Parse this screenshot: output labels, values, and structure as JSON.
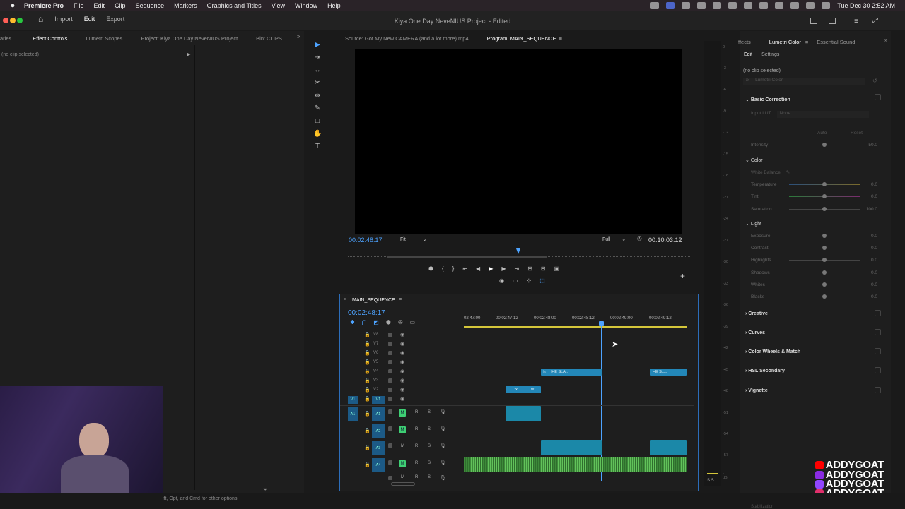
{
  "menubar": {
    "app_name": "Premiere Pro",
    "items": [
      "File",
      "Edit",
      "Clip",
      "Sequence",
      "Markers",
      "Graphics and Titles",
      "View",
      "Window",
      "Help"
    ],
    "clock": "Tue Dec 30  2:52 AM"
  },
  "titlebar": {
    "nav": {
      "import": "Import",
      "edit": "Edit",
      "export": "Export"
    },
    "title": "Kiya One Day NeveNIUS Project",
    "status": "- Edited"
  },
  "effect_controls": {
    "tabs": [
      "aries",
      "Effect Controls",
      "Lumetri Scopes",
      "Project: Kiya One Day NeveNIUS Project",
      "Bin: CLIPS"
    ],
    "selected_tab": 1,
    "no_clip": "(no clip selected)"
  },
  "program": {
    "source_tab": "Source: Got My New CAMERA (and a lot more).mp4",
    "program_tab": "Program: MAIN_SEQUENCE",
    "timecode": "00:02:48:17",
    "fit": "Fit",
    "quality": "Full",
    "duration": "00:10:03:12"
  },
  "timeline": {
    "sequence_name": "MAIN_SEQUENCE",
    "timecode": "00:02:48:17",
    "ruler": [
      "02:47:00",
      "00:02:47:12",
      "00:02:48:00",
      "00:02:48:12",
      "00:02:49:00",
      "00:02:49:12"
    ],
    "video_tracks": [
      "V8",
      "V7",
      "V6",
      "V5",
      "V4",
      "V3",
      "V2",
      "V1"
    ],
    "audio_tracks": [
      "A1",
      "A2",
      "A3",
      "A4"
    ],
    "src_v": "V1",
    "src_a": "A1",
    "mute_label": "M",
    "record_label": "R",
    "solo_label": "S",
    "clips": {
      "v4_a": "HE SLA...",
      "v4_b": "HE SL...",
      "fx": "fx"
    }
  },
  "lumetri": {
    "tabs": [
      "ffects",
      "Lumetri Color",
      "Essential Sound"
    ],
    "subtabs": [
      "Edit",
      "Settings"
    ],
    "no_clip": "(no clip selected)",
    "fx_label": "Lumetri Color",
    "basic": "Basic Correction",
    "input_lut": "Input LUT",
    "lut_value": "None",
    "auto": "Auto",
    "reset": "Reset",
    "intensity": {
      "label": "Intensity",
      "value": "50.0"
    },
    "color": "Color",
    "white_balance": "White Balance",
    "color_rows": [
      {
        "label": "Temperature",
        "value": "0.0"
      },
      {
        "label": "Tint",
        "value": "0.0"
      },
      {
        "label": "Saturation",
        "value": "100.0"
      }
    ],
    "light": "Light",
    "light_rows": [
      {
        "label": "Exposure",
        "value": "0.0"
      },
      {
        "label": "Contrast",
        "value": "0.0"
      },
      {
        "label": "Highlights",
        "value": "0.0"
      },
      {
        "label": "Shadows",
        "value": "0.0"
      },
      {
        "label": "Whites",
        "value": "0.0"
      },
      {
        "label": "Blacks",
        "value": "0.0"
      }
    ],
    "sections": [
      "Creative",
      "Curves",
      "Color Wheels & Match",
      "HSL Secondary",
      "Vignette"
    ]
  },
  "meter": {
    "labels": [
      "0",
      "-3",
      "-6",
      "-9",
      "-12",
      "-15",
      "-18",
      "-21",
      "-24",
      "-27",
      "-30",
      "-33",
      "-36",
      "-39",
      "-42",
      "-45",
      "-48",
      "-51",
      "-54",
      "-57",
      "-dB"
    ],
    "ss": "S S"
  },
  "watermark": [
    "ADDYGOAT",
    "ADDYGOAT",
    "ADDYGOAT",
    "ADDYGOAT"
  ],
  "watermark_colors": [
    "#ff0000",
    "#8a2be2",
    "#9146ff",
    "#e1306c"
  ],
  "status": {
    "hint": "ift, Opt, and Cmd for other options.",
    "right": "Stabilization"
  },
  "colors": {
    "accent": "#2c6db9",
    "clip_video": "#2387b8",
    "mute_green": "#3ecf74"
  }
}
